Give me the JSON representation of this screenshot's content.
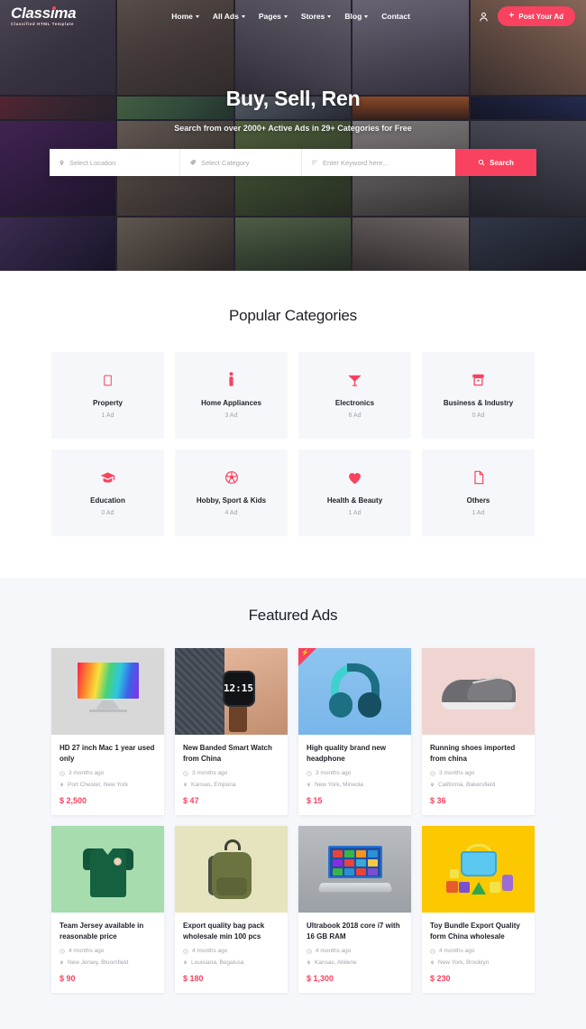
{
  "brand": {
    "name": "Classima",
    "tagline": "Classified HTML Template",
    "accent": "#f9425f"
  },
  "nav": {
    "items": [
      {
        "label": "Home",
        "has_dropdown": true
      },
      {
        "label": "All Ads",
        "has_dropdown": true
      },
      {
        "label": "Pages",
        "has_dropdown": true
      },
      {
        "label": "Stores",
        "has_dropdown": true
      },
      {
        "label": "Blog",
        "has_dropdown": true
      },
      {
        "label": "Contact",
        "has_dropdown": false
      }
    ],
    "account_icon": "user-icon",
    "post_ad_label": "Post Your Ad",
    "post_ad_icon": "plus-icon"
  },
  "hero": {
    "title": "Buy, Sell, Ren",
    "subtitle": "Search from over 2000+ Active Ads in 29+ Categories for Free"
  },
  "search": {
    "location_placeholder": "Select Location",
    "location_icon": "map-pin-icon",
    "category_placeholder": "Select Category",
    "category_icon": "tag-icon",
    "keyword_placeholder": "Enter Keyword here...",
    "keyword_icon": "sliders-icon",
    "button_label": "Search",
    "button_icon": "search-icon"
  },
  "categories_section": {
    "title": "Popular Categories",
    "items": [
      {
        "name": "Property",
        "count": "1 Ad",
        "icon": "building-icon"
      },
      {
        "name": "Home Appliances",
        "count": "3 Ad",
        "icon": "person-icon"
      },
      {
        "name": "Electronics",
        "count": "6 Ad",
        "icon": "cocktail-icon"
      },
      {
        "name": "Business & Industry",
        "count": "0 Ad",
        "icon": "box-icon"
      },
      {
        "name": "Education",
        "count": "0 Ad",
        "icon": "graduation-cap-icon"
      },
      {
        "name": "Hobby, Sport & Kids",
        "count": "4 Ad",
        "icon": "soccer-ball-icon"
      },
      {
        "name": "Health & Beauty",
        "count": "1 Ad",
        "icon": "heart-icon"
      },
      {
        "name": "Others",
        "count": "1 Ad",
        "icon": "file-icon"
      }
    ]
  },
  "featured_section": {
    "title": "Featured Ads",
    "time_icon": "clock-icon",
    "location_icon": "map-pin-icon",
    "ads": [
      {
        "title": "HD 27 inch Mac 1 year used only",
        "time": "3 months ago",
        "location": "Port Chester, New York",
        "price": "$ 2,500",
        "featured_badge": false,
        "thumb": "imac-monitor"
      },
      {
        "title": "New Banded Smart Watch from China",
        "time": "3 months ago",
        "location": "Kansas, Emporia",
        "price": "$ 47",
        "featured_badge": false,
        "thumb": "smart-watch",
        "watch_time": "12:15"
      },
      {
        "title": "High quality brand new headphone",
        "time": "3 months ago",
        "location": "New York, Mineola",
        "price": "$ 15",
        "featured_badge": true,
        "thumb": "headphone"
      },
      {
        "title": "Running shoes imported from china",
        "time": "3 months ago",
        "location": "California, Bakersfield",
        "price": "$ 36",
        "featured_badge": false,
        "thumb": "running-shoe"
      },
      {
        "title": "Team Jersey available in reasonable price",
        "time": "4 months ago",
        "location": "New Jersey, Bloomfield",
        "price": "$ 90",
        "featured_badge": false,
        "thumb": "team-jersey"
      },
      {
        "title": "Export quality bag pack wholesale min 100 pcs",
        "time": "4 months ago",
        "location": "Louisiana, Bogalusa",
        "price": "$ 180",
        "featured_badge": false,
        "thumb": "backpack"
      },
      {
        "title": "Ultrabook 2018 core i7 with 16 GB RAM",
        "time": "4 months ago",
        "location": "Kansas, Abilene",
        "price": "$ 1,300",
        "featured_badge": false,
        "thumb": "laptop"
      },
      {
        "title": "Toy Bundle Export Quality form China wholesale",
        "time": "4 months ago",
        "location": "New York, Brooklyn",
        "price": "$ 230",
        "featured_badge": false,
        "thumb": "toy-bundle"
      }
    ]
  }
}
